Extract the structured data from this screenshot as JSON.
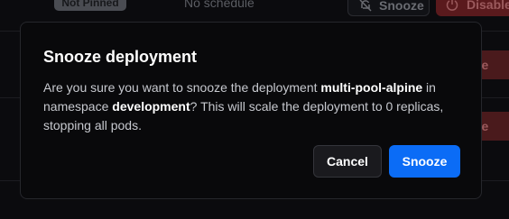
{
  "background": {
    "pinned_badge": "Not Pinned",
    "schedule_text": "No schedule",
    "snooze_label": "Snooze",
    "disable_label": "Disable",
    "disable_partial_label": "ble"
  },
  "dialog": {
    "title": "Snooze deployment",
    "body_prefix": "Are you sure you want to snooze the deployment ",
    "deployment_name": "multi-pool-alpine",
    "body_middle": " in namespace ",
    "namespace": "development",
    "body_suffix": "? This will scale the deployment to 0 replicas, stopping all pods.",
    "cancel_label": "Cancel",
    "confirm_label": "Snooze"
  },
  "colors": {
    "primary": "#0b6cf6",
    "danger": "#5a1a1d",
    "surface": "#09090b"
  }
}
